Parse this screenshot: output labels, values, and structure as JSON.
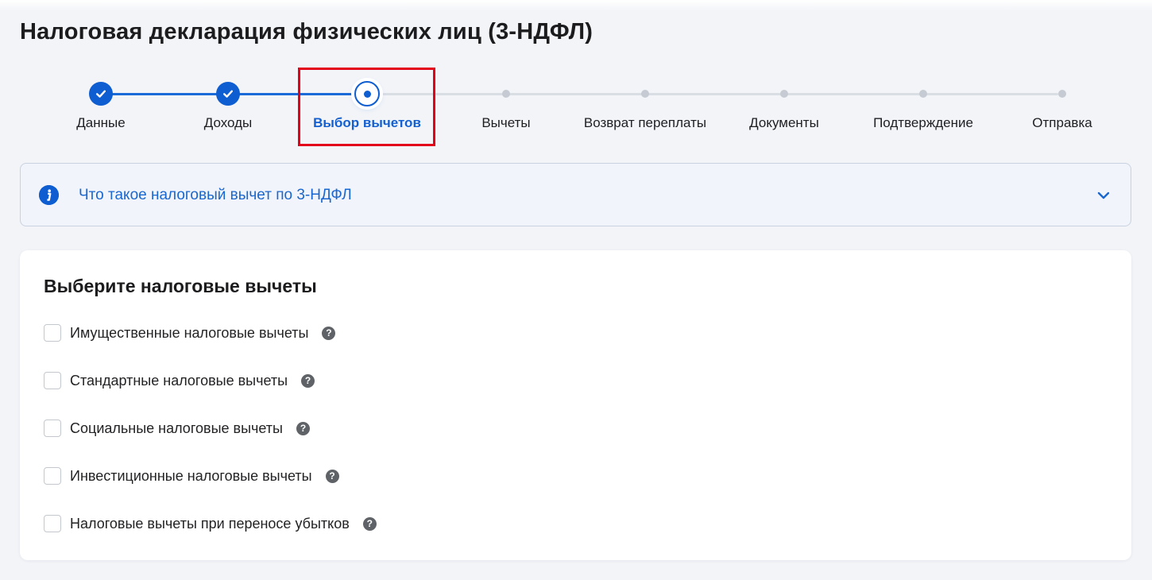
{
  "page": {
    "title": "Налоговая декларация физических лиц (3-НДФЛ)"
  },
  "stepper": {
    "steps": [
      {
        "label": "Данные",
        "status": "done"
      },
      {
        "label": "Доходы",
        "status": "done"
      },
      {
        "label": "Выбор вычетов",
        "status": "active"
      },
      {
        "label": "Вычеты",
        "status": "todo"
      },
      {
        "label": "Возврат переплаты",
        "status": "todo"
      },
      {
        "label": "Документы",
        "status": "todo"
      },
      {
        "label": "Подтверждение",
        "status": "todo"
      },
      {
        "label": "Отправка",
        "status": "todo"
      }
    ]
  },
  "info_panel": {
    "title": "Что такое налоговый вычет по 3-НДФЛ",
    "icon": "info-icon",
    "expand_icon": "chevron-down-icon"
  },
  "deductions": {
    "title": "Выберите налоговые вычеты",
    "options": [
      {
        "label": "Имущественные налоговые вычеты",
        "checked": false,
        "help": "?"
      },
      {
        "label": "Стандартные налоговые вычеты",
        "checked": false,
        "help": "?"
      },
      {
        "label": "Социальные налоговые вычеты",
        "checked": false,
        "help": "?"
      },
      {
        "label": "Инвестиционные налоговые вычеты",
        "checked": false,
        "help": "?"
      },
      {
        "label": "Налоговые вычеты при переносе убытков",
        "checked": false,
        "help": "?"
      }
    ]
  },
  "colors": {
    "accent": "#0e5dd1",
    "highlight": "#e3001b",
    "background": "#f2f4f8"
  }
}
